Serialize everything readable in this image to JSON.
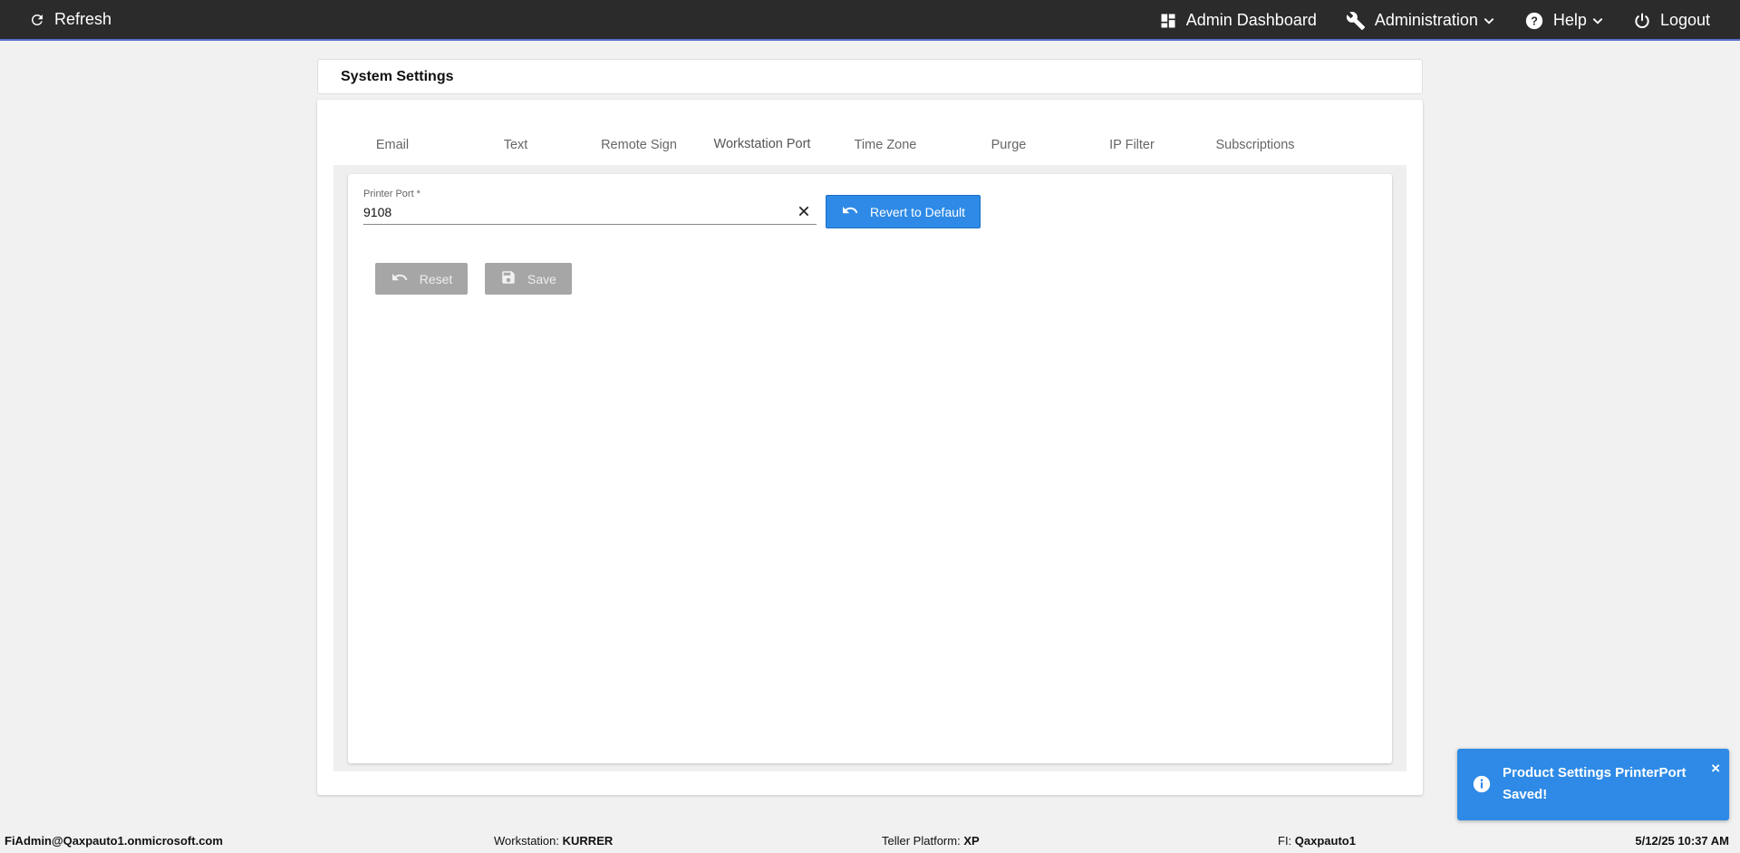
{
  "topbar": {
    "refresh_label": "Refresh",
    "admin_dashboard_label": "Admin Dashboard",
    "administration_label": "Administration",
    "help_label": "Help",
    "logout_label": "Logout"
  },
  "page": {
    "title": "System Settings"
  },
  "tabs": [
    {
      "label": "Email"
    },
    {
      "label": "Text"
    },
    {
      "label": "Remote Sign"
    },
    {
      "label": "Workstation Port",
      "active": true
    },
    {
      "label": "Time Zone"
    },
    {
      "label": "Purge"
    },
    {
      "label": "IP Filter"
    },
    {
      "label": "Subscriptions"
    }
  ],
  "form": {
    "printer_port_label": "Printer Port *",
    "printer_port_value": "9108",
    "revert_label": "Revert to Default",
    "reset_label": "Reset",
    "save_label": "Save"
  },
  "toast": {
    "message": "Product Settings PrinterPort Saved!",
    "close": "×"
  },
  "footer": {
    "user": "FiAdmin@Qaxpauto1.onmicrosoft.com",
    "workstation_label": "Workstation:",
    "workstation_value": "KURRER",
    "teller_platform_label": "Teller Platform:",
    "teller_platform_value": "XP",
    "fi_label": "FI:",
    "fi_value": "Qaxpauto1",
    "datetime": "5/12/25 10:37 AM"
  },
  "colors": {
    "topbar": "#2b2b2b",
    "accent": "#2e8ae6",
    "tab_indicator": "#3f51b5",
    "disabled_button": "#a6a6a6"
  },
  "icons": [
    "refresh-icon",
    "dashboard-icon",
    "wrench-icon",
    "help-icon",
    "power-icon",
    "chevron-down-icon",
    "close-icon",
    "undo-icon",
    "save-icon",
    "info-icon"
  ]
}
